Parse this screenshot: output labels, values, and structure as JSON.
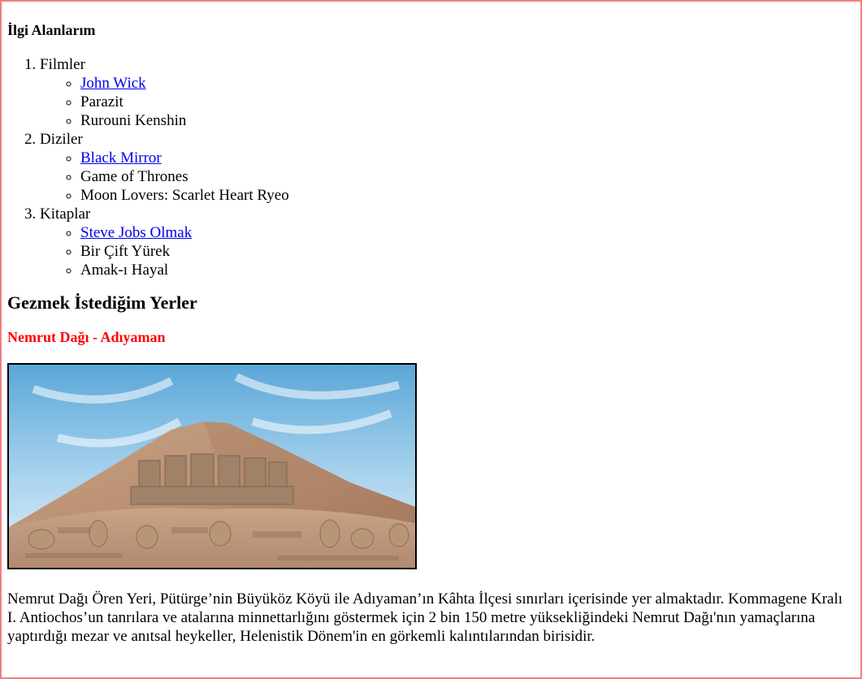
{
  "interests": {
    "title": "İlgi Alanlarım",
    "categories": [
      {
        "label": "Filmler",
        "items": [
          {
            "label": "John Wick",
            "link": true
          },
          {
            "label": "Parazit",
            "link": false
          },
          {
            "label": "Rurouni Kenshin",
            "link": false
          }
        ]
      },
      {
        "label": "Diziler",
        "items": [
          {
            "label": "Black Mirror",
            "link": true
          },
          {
            "label": "Game of Thrones",
            "link": false
          },
          {
            "label": "Moon Lovers: Scarlet Heart Ryeo",
            "link": false
          }
        ]
      },
      {
        "label": "Kitaplar",
        "items": [
          {
            "label": "Steve Jobs Olmak",
            "link": true
          },
          {
            "label": "Bir Çift Yürek",
            "link": false
          },
          {
            "label": "Amak-ı Hayal",
            "link": false
          }
        ]
      }
    ]
  },
  "places": {
    "title": "Gezmek İstediğim Yerler",
    "place_name": "Nemrut Dağı - Adıyaman",
    "place_name_color": "#ff0000",
    "description": "Nemrut Dağı Ören Yeri, Pütürge’nin Büyüköz Köyü ile Adıyaman’ın Kâhta İlçesi sınırları içerisinde yer almaktadır. Kommagene Kralı I. Antiochos’un tanrılara ve atalarına minnettarlığını göstermek için 2 bin 150 metre yüksekliğindeki Nemrut Dağı'nın yamaçlarına yaptırdığı mezar ve anıtsal heykeller, Helenistik Dönem'in en görkemli kalıntılarından birisidir."
  },
  "colors": {
    "frame_border": "#f08080",
    "link": "#0000ee"
  }
}
